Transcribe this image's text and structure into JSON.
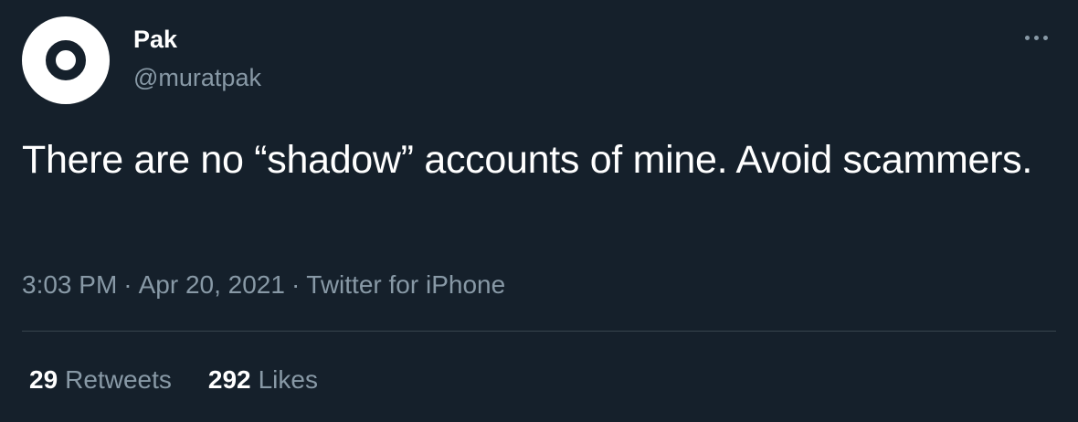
{
  "author": {
    "display_name": "Pak",
    "handle": "@muratpak",
    "avatar_icon": "circle-logo-icon"
  },
  "more_icon": "more-horizontal-icon",
  "tweet": {
    "text": "There are no “shadow” accounts of mine. Avoid scammers.",
    "time": "3:03 PM",
    "separator": "·",
    "date": "Apr 20, 2021",
    "source": "Twitter for iPhone"
  },
  "stats": {
    "retweets_count": "29",
    "retweets_label": "Retweets",
    "likes_count": "292",
    "likes_label": "Likes"
  },
  "colors": {
    "background": "#15202b",
    "primary_text": "#ffffff",
    "secondary_text": "#8899a6",
    "divider": "#38444d"
  }
}
